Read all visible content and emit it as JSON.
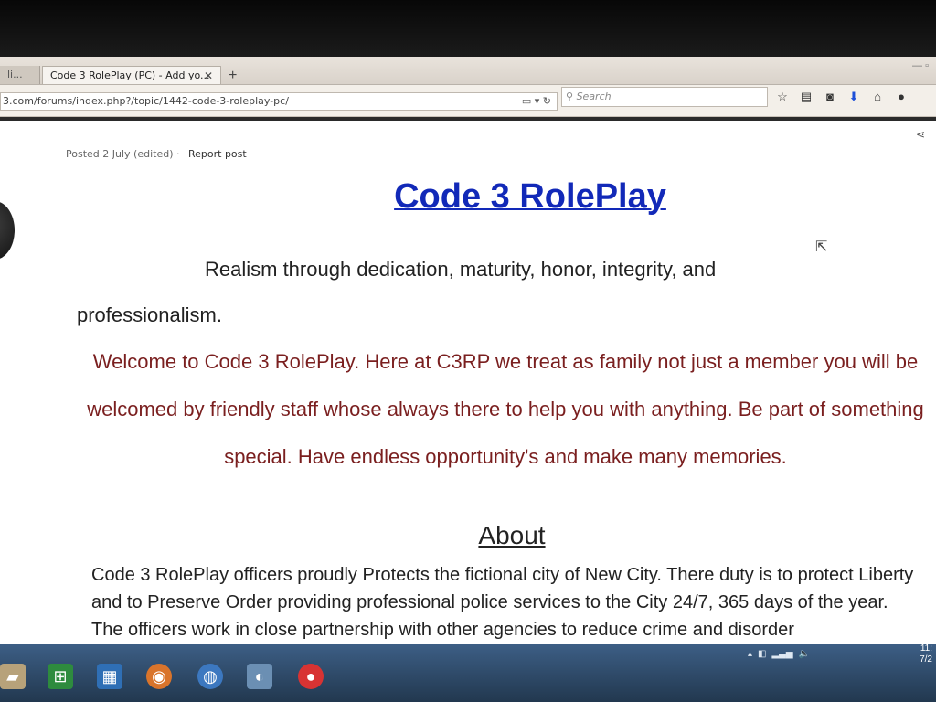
{
  "browser": {
    "inactive_tab_label": "li...",
    "active_tab_label": "Code 3 RolePlay (PC) - Add yo...",
    "tab_close": "✕",
    "new_tab": "+",
    "url": "3.com/forums/index.php?/topic/1442-code-3-roleplay-pc/",
    "search_placeholder": "Search"
  },
  "post": {
    "meta": "Posted 2 July (edited) ·",
    "report": "Report post",
    "title": "Code 3 RolePlay",
    "motto_line1": "Realism through dedication, maturity, honor, integrity, and",
    "motto_line2": "professionalism.",
    "welcome": "Welcome to Code 3 RolePlay. Here at C3RP we treat as family not just a member you will be welcomed by friendly staff whose always there to help you with anything. Be part of something special. Have endless opportunity's and make many memories.",
    "about_heading": "About",
    "about_text": "Code 3 RolePlay officers proudly Protects the fictional city of New City. There duty is to protect Liberty and to Preserve Order providing professional police services to the City 24/7, 365 days of the year. The officers work in close partnership with other agencies to reduce crime and disorder"
  },
  "taskbar": {
    "clock_time": "11:",
    "clock_date": "7/2"
  },
  "colors": {
    "title": "#1229b8",
    "welcome_text": "#7a1f1f",
    "taskbar": "#2f4a6a"
  }
}
